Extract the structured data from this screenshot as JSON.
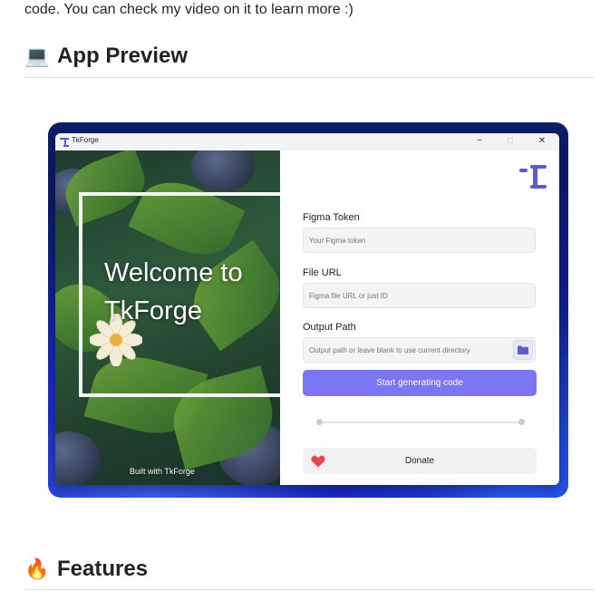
{
  "intro_text": "code. You can check my video on it to learn more :)",
  "sections": {
    "app_preview": {
      "emoji": "💻",
      "title": "App Preview"
    },
    "features": {
      "emoji": "🔥",
      "title": "Features"
    }
  },
  "preview": {
    "window_title": "TkForge",
    "window_controls": {
      "minimize": "−",
      "maximize": "□",
      "close": "✕"
    },
    "welcome_line1": "Welcome to",
    "welcome_line2": "TkForge",
    "built_with": "Built with TkForge",
    "figma_token_label": "Figma Token",
    "figma_token_placeholder": "Your Figma token",
    "file_url_label": "File URL",
    "file_url_placeholder": "Figma file URL or just ID",
    "output_path_label": "Output Path",
    "output_path_placeholder": "Output path or leave blank to use current directory",
    "generate_button": "Start generating code",
    "donate_button": "Donate",
    "icons": [
      "tkforge-logo-icon",
      "folder-icon",
      "heart-icon"
    ],
    "colors": {
      "accent": "#7b76f5",
      "heart": "#e5484d",
      "logo": "#5b5bd6"
    }
  }
}
